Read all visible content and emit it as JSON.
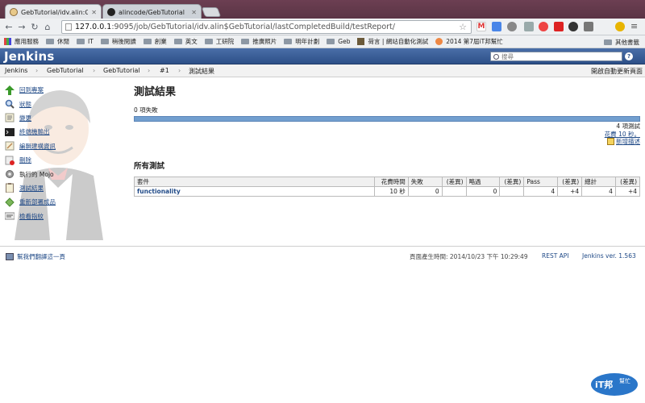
{
  "browser": {
    "tabs": [
      {
        "title": "GebTutorial/idv.alin:GebTu"
      },
      {
        "title": "alincode/GebTutorial"
      }
    ],
    "url_host": "127.0.0.1",
    "url_rest": ":9095/job/GebTutorial/idv.alin$GebTutorial/lastCompletedBuild/testReport/",
    "bookmarks": [
      {
        "label": "應用服務",
        "icon": "apps-icon"
      },
      {
        "label": "休閒",
        "icon": "folder-icon"
      },
      {
        "label": "IT",
        "icon": "folder-icon"
      },
      {
        "label": "稍後閱讀",
        "icon": "folder-icon"
      },
      {
        "label": "創業",
        "icon": "folder-icon"
      },
      {
        "label": "英文",
        "icon": "folder-icon"
      },
      {
        "label": "工研院",
        "icon": "folder-icon"
      },
      {
        "label": "推廣照片",
        "icon": "folder-icon"
      },
      {
        "label": "明年計劃",
        "icon": "folder-icon"
      },
      {
        "label": "Geb",
        "icon": "folder-icon"
      },
      {
        "label": "荷言 | 網站自動化測試",
        "icon": "book-icon"
      },
      {
        "label": "2014 第7屆iT邦幫忙",
        "icon": "ithelp-icon"
      }
    ],
    "other_bookmarks": "其他書籤"
  },
  "jenkins": {
    "logo": "Jenkins",
    "search_placeholder": "搜尋",
    "help": "?"
  },
  "breadcrumbs": [
    "Jenkins",
    "GebTutorial",
    "GebTutorial",
    "#1",
    "測試結果"
  ],
  "auto_refresh": "開啟自動更新頁面",
  "sidebar": {
    "items": [
      {
        "label": "回到專案",
        "icon": "arrow-up-icon"
      },
      {
        "label": "狀態",
        "icon": "magnifier-icon"
      },
      {
        "label": "變更",
        "icon": "notepad-icon"
      },
      {
        "label": "終端機輸出",
        "icon": "terminal-icon"
      },
      {
        "label": "編輯建構資訊",
        "icon": "notepad-icon"
      },
      {
        "label": "刪除",
        "icon": "delete-icon"
      },
      {
        "label": "執行的 Mojo",
        "icon": "gear-icon"
      },
      {
        "label": "測試結果",
        "icon": "clipboard-icon"
      },
      {
        "label": "重新部署成品",
        "icon": "redeploy-icon"
      },
      {
        "label": "檢看指紋",
        "icon": "fingerprint-icon"
      }
    ]
  },
  "main": {
    "title": "測試結果",
    "fail_count": "0 項失敗",
    "pass_fraction": 1.0,
    "total_tests": "4 項測試",
    "duration": "花費 10 秒。",
    "add_description": "新增描述",
    "all_tests_title": "所有測試",
    "table": {
      "headers": [
        "套件",
        "花費時間",
        "失敗",
        "(差異)",
        "略過",
        "(差異)",
        "Pass",
        "(差異)",
        "總計",
        "(差異)"
      ],
      "rows": [
        [
          "functionality",
          "10 秒",
          "0",
          "",
          "0",
          "",
          "4",
          "+4",
          "4",
          "+4"
        ]
      ]
    }
  },
  "footer": {
    "help_translate": "幫我們翻譯這一頁",
    "generated": "頁面產生時間: 2014/10/23 下午 10:29:49",
    "rest_api": "REST API",
    "version": "Jenkins ver. 1.563"
  },
  "watermark": {
    "line1": "iT邦",
    "line2": "幫忙"
  }
}
